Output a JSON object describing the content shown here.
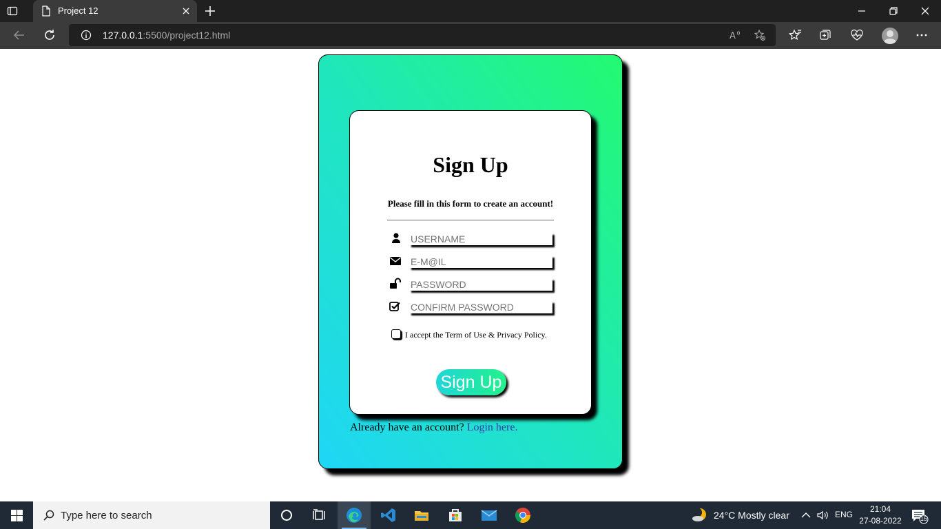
{
  "browser": {
    "tab_title": "Project 12",
    "url_host": "127.0.0.1",
    "url_rest": ":5500/project12.html"
  },
  "form": {
    "title": "Sign Up",
    "subtitle": "Please fill in this form to create an account!",
    "fields": [
      {
        "icon": "user-icon",
        "placeholder": "USERNAME"
      },
      {
        "icon": "envelope-icon",
        "placeholder": "E-M@IL"
      },
      {
        "icon": "unlock-icon",
        "placeholder": "PASSWORD"
      },
      {
        "icon": "check-square-icon",
        "placeholder": "CONFIRM PASSWORD"
      }
    ],
    "terms_text": "I accept the Term of Use & Privacy Policy.",
    "terms_checked": false,
    "submit_label": "Sign Up"
  },
  "footer": {
    "already_text": "Already have an account?",
    "login_link": "Login here."
  },
  "colors": {
    "gradient_bottom": "#1fd6f6",
    "gradient_top": "#23fa70",
    "link": "#3a3aa8"
  },
  "taskbar": {
    "search_placeholder": "Type here to search",
    "weather": "24°C  Mostly clear",
    "language": "ENG",
    "time": "21:04",
    "date": "27-08-2022",
    "notification_count": "15"
  }
}
